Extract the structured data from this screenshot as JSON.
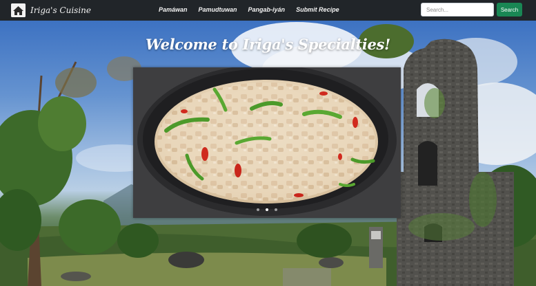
{
  "navbar": {
    "brand": "Iriga's Cuisine",
    "links": [
      "Pamáwan",
      "Pamudtuwan",
      "Pangab-iyán",
      "Submit Recipe"
    ],
    "search": {
      "value": "",
      "placeholder": "Search...",
      "button_label": "Search"
    },
    "colors": {
      "background": "#212529",
      "button": "#198754"
    }
  },
  "hero": {
    "title": "Welcome to Iriga's Specialties!",
    "carousel": {
      "slide_count": 3,
      "active_slide": 2
    }
  },
  "icons": {
    "brand_logo": "house-logo-icon"
  }
}
